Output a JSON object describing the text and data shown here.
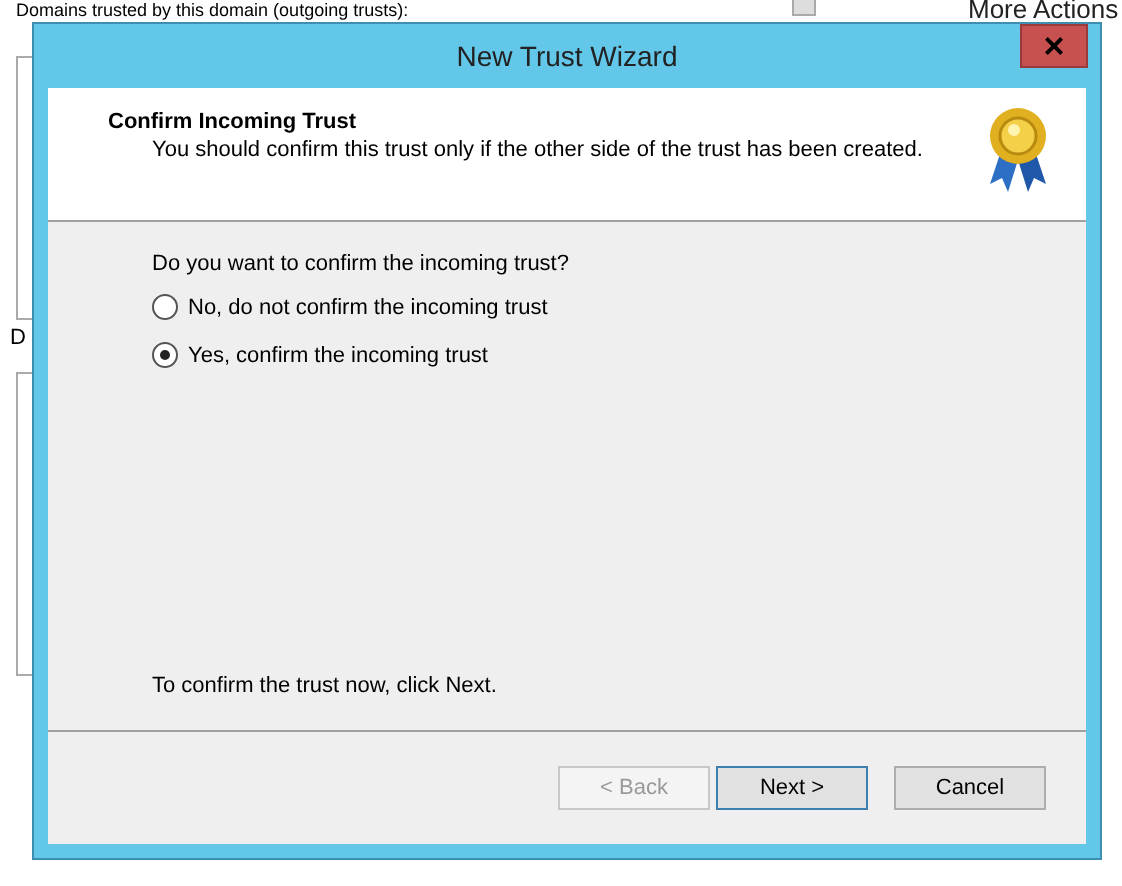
{
  "background": {
    "list_label": "Domains trusted by this domain (outgoing trusts):",
    "side_label": "D",
    "actions_label": "More Actions"
  },
  "window": {
    "title": "New Trust Wizard",
    "close": "×"
  },
  "header": {
    "title": "Confirm Incoming Trust",
    "subtitle": "You should confirm this trust only if the other side of the trust has been created."
  },
  "question": "Do you want to confirm the incoming trust?",
  "options": [
    {
      "label": "No, do not confirm the incoming trust",
      "selected": false
    },
    {
      "label": "Yes, confirm the incoming trust",
      "selected": true
    }
  ],
  "hint": "To confirm the trust now, click Next.",
  "buttons": [
    {
      "label": "< Back",
      "disabled": true,
      "default": false
    },
    {
      "label": "Next >",
      "disabled": false,
      "default": true
    },
    {
      "label": "Cancel",
      "disabled": false,
      "default": false
    }
  ]
}
